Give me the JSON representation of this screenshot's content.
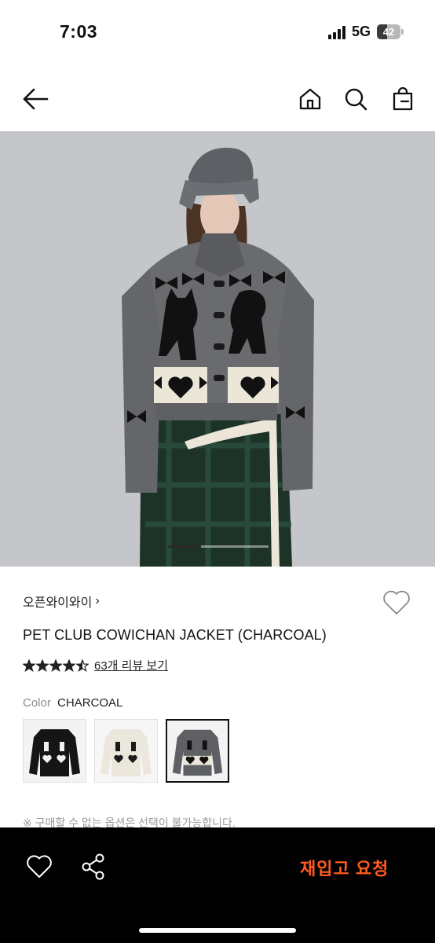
{
  "status_bar": {
    "time": "7:03",
    "network": "5G",
    "battery_level": "42",
    "battery_percent": 42
  },
  "nav": {
    "back_icon": "arrow-left-icon",
    "home_icon": "home-icon",
    "search_icon": "search-icon",
    "cart_icon": "shopping-bag-icon"
  },
  "gallery": {
    "slide_progress": 0.33,
    "background": "#c4c6c9"
  },
  "product": {
    "brand": "오픈와이와이",
    "brand_chevron": "›",
    "title": "PET CLUB COWICHAN JACKET (CHARCOAL)",
    "rating": 4.5,
    "review_link": "63개 리뷰 보기",
    "color_label": "Color",
    "color_value": "CHARCOAL",
    "color_options": [
      {
        "name": "black",
        "selected": false
      },
      {
        "name": "ivory",
        "selected": false
      },
      {
        "name": "charcoal",
        "selected": true
      }
    ],
    "notice": "※ 구매할 수 없는 옵션은 선택이 불가능합니다."
  },
  "bottom_bar": {
    "wishlist_icon": "heart-icon",
    "share_icon": "share-icon",
    "restock_button": "재입고 요청",
    "accent_color": "#ff5a1f"
  }
}
